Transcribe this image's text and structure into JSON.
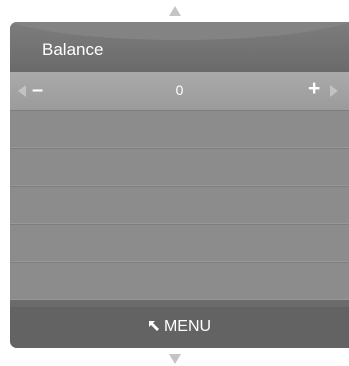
{
  "nav": {
    "up_icon": "arrow-up-icon",
    "down_icon": "arrow-down-icon"
  },
  "panel": {
    "title": "Balance",
    "control": {
      "value": "0",
      "decrease_label": "–",
      "increase_label": "+",
      "left_icon": "triangle-left-icon",
      "right_icon": "triangle-right-icon"
    },
    "empty_rows": 5,
    "footer": {
      "menu_label": "MENU",
      "menu_icon": "return-arrow-icon"
    }
  },
  "colors": {
    "panel": "#6b6b6b",
    "selected_row": "#a3a3a3",
    "rows": "#8c8c8c",
    "footer": "#636363",
    "arrows": "#c4c4c4",
    "text": "#ffffff"
  }
}
